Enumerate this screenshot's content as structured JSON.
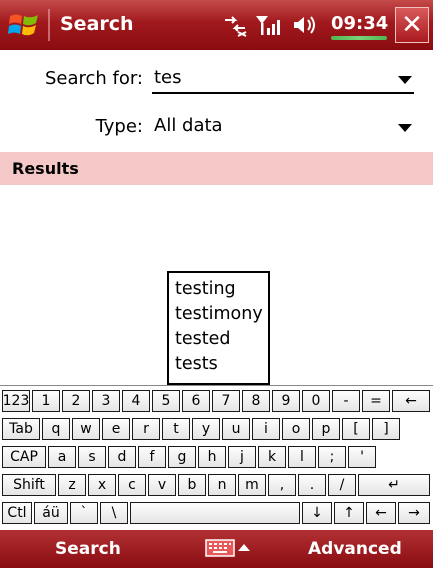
{
  "titlebar": {
    "title": "Search",
    "time": "09:34",
    "close": "✕"
  },
  "form": {
    "search_label": "Search for:",
    "search_value": "tes",
    "type_label": "Type:",
    "type_value": "All data"
  },
  "results": {
    "header": "Results"
  },
  "suggestions": [
    "testing",
    "testimony",
    "tested",
    "tests"
  ],
  "keyboard": {
    "rows": [
      [
        "123",
        "1",
        "2",
        "3",
        "4",
        "5",
        "6",
        "7",
        "8",
        "9",
        "0",
        "-",
        "=",
        "←"
      ],
      [
        "Tab",
        "q",
        "w",
        "e",
        "r",
        "t",
        "y",
        "u",
        "i",
        "o",
        "p",
        "[",
        "]"
      ],
      [
        "CAP",
        "a",
        "s",
        "d",
        "f",
        "g",
        "h",
        "j",
        "k",
        "l",
        ";",
        "'"
      ],
      [
        "Shift",
        "z",
        "x",
        "c",
        "v",
        "b",
        "n",
        "m",
        ",",
        ".",
        "/",
        "↵"
      ],
      [
        "Ctl",
        "áü",
        "`",
        "\\",
        "",
        "↓",
        "↑",
        "←",
        "→"
      ]
    ]
  },
  "softkeys": {
    "left": "Search",
    "right": "Advanced"
  },
  "colors": {
    "titlebar": "#a1191d",
    "results_bar": "#f4c8c6",
    "softbar": "#8a0c10"
  }
}
